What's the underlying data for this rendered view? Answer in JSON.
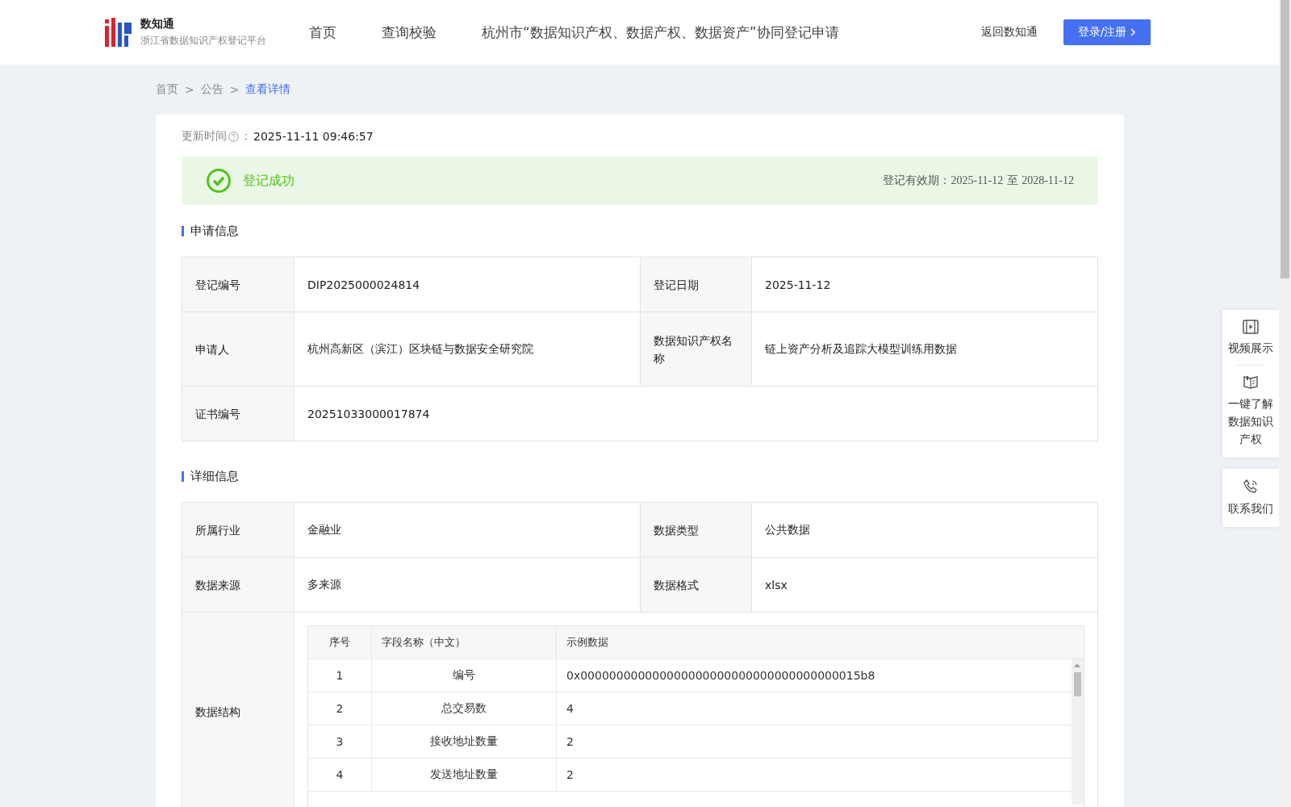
{
  "header": {
    "logo_title": "数知通",
    "logo_subtitle": "浙江省数据知识产权登记平台",
    "nav": [
      {
        "label": "首页",
        "selected": false
      },
      {
        "label": "查询校验",
        "selected": false
      },
      {
        "label": "杭州市“数据知识产权、数据产权、数据资产”协同登记申请",
        "selected": false
      }
    ],
    "back_link": "返回数知通",
    "login_button": "登录/注册"
  },
  "breadcrumb": [
    {
      "label": "首页",
      "selected": false
    },
    {
      "label": "公告",
      "selected": false
    },
    {
      "label": "查看详情",
      "selected": true
    }
  ],
  "breadcrumb_separator": ">",
  "update": {
    "label": "更新时间",
    "colon": "：",
    "value": "2025-11-11 09:46:57"
  },
  "status": {
    "text": "登记成功",
    "validity_label": "登记有效期：",
    "validity_from": "2025-11-12",
    "validity_to_word": "至",
    "validity_to": "2028-11-12"
  },
  "application": {
    "title": "申请信息",
    "rows": [
      {
        "cells": [
          {
            "label": "登记编号",
            "value": "DIP2025000024814"
          },
          {
            "label": "登记日期",
            "value": "2025-11-12"
          }
        ]
      },
      {
        "cells": [
          {
            "label": "申请人",
            "value": "杭州高新区（滨江）区块链与数据安全研究院"
          },
          {
            "label": "数据知识产权名称",
            "value": "链上资产分析及追踪大模型训练用数据"
          }
        ]
      },
      {
        "cells": [
          {
            "label": "证书编号",
            "value": "20251033000017874"
          }
        ]
      }
    ]
  },
  "details": {
    "title": "详细信息",
    "rows": [
      {
        "cells": [
          {
            "label": "所属行业",
            "value": "金融业"
          },
          {
            "label": "数据类型",
            "value": "公共数据"
          }
        ]
      },
      {
        "cells": [
          {
            "label": "数据来源",
            "value": "多来源"
          },
          {
            "label": "数据格式",
            "value": "xlsx"
          }
        ]
      }
    ],
    "structure": {
      "label": "数据结构",
      "columns": [
        "序号",
        "字段名称（中文）",
        "示例数据"
      ],
      "rows": [
        [
          "1",
          "编号",
          "0x000000000000000000000000000000000000015b8"
        ],
        [
          "2",
          "总交易数",
          "4"
        ],
        [
          "3",
          "接收地址数量",
          "2"
        ],
        [
          "4",
          "发送地址数量",
          "2"
        ]
      ]
    }
  },
  "side_panel": [
    {
      "kind": "video",
      "label": "视频展示"
    },
    {
      "kind": "book",
      "label": "一键了解数据知识产权"
    },
    {
      "kind": "phone",
      "label": "联系我们"
    }
  ]
}
